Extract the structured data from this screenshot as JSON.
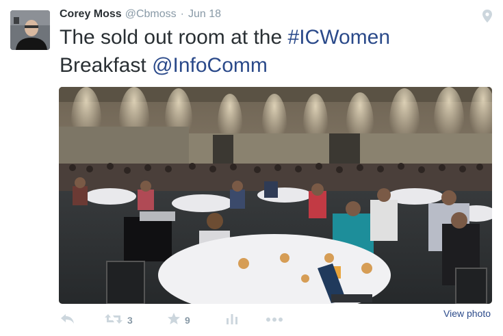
{
  "tweet": {
    "author_name": "Corey Moss",
    "handle": "@Cbmoss",
    "separator": "·",
    "timestamp": "Jun 18",
    "text_plain_1": "The sold out room at the ",
    "hashtag": "#ICWomen",
    "text_plain_2": "Breakfast ",
    "mention": "@InfoComm",
    "view_photo_label": "View photo"
  },
  "actions": {
    "reply_icon": "reply-icon",
    "retweet_icon": "retweet-icon",
    "retweet_count": "3",
    "favorite_icon": "star-icon",
    "favorite_count": "9",
    "analytics_icon": "bar-chart-icon",
    "more_icon": "more-dots-icon"
  },
  "colors": {
    "name": "#292f33",
    "muted": "#8899a6",
    "link": "#2b4a8a",
    "icon": "#ccd6dd"
  }
}
